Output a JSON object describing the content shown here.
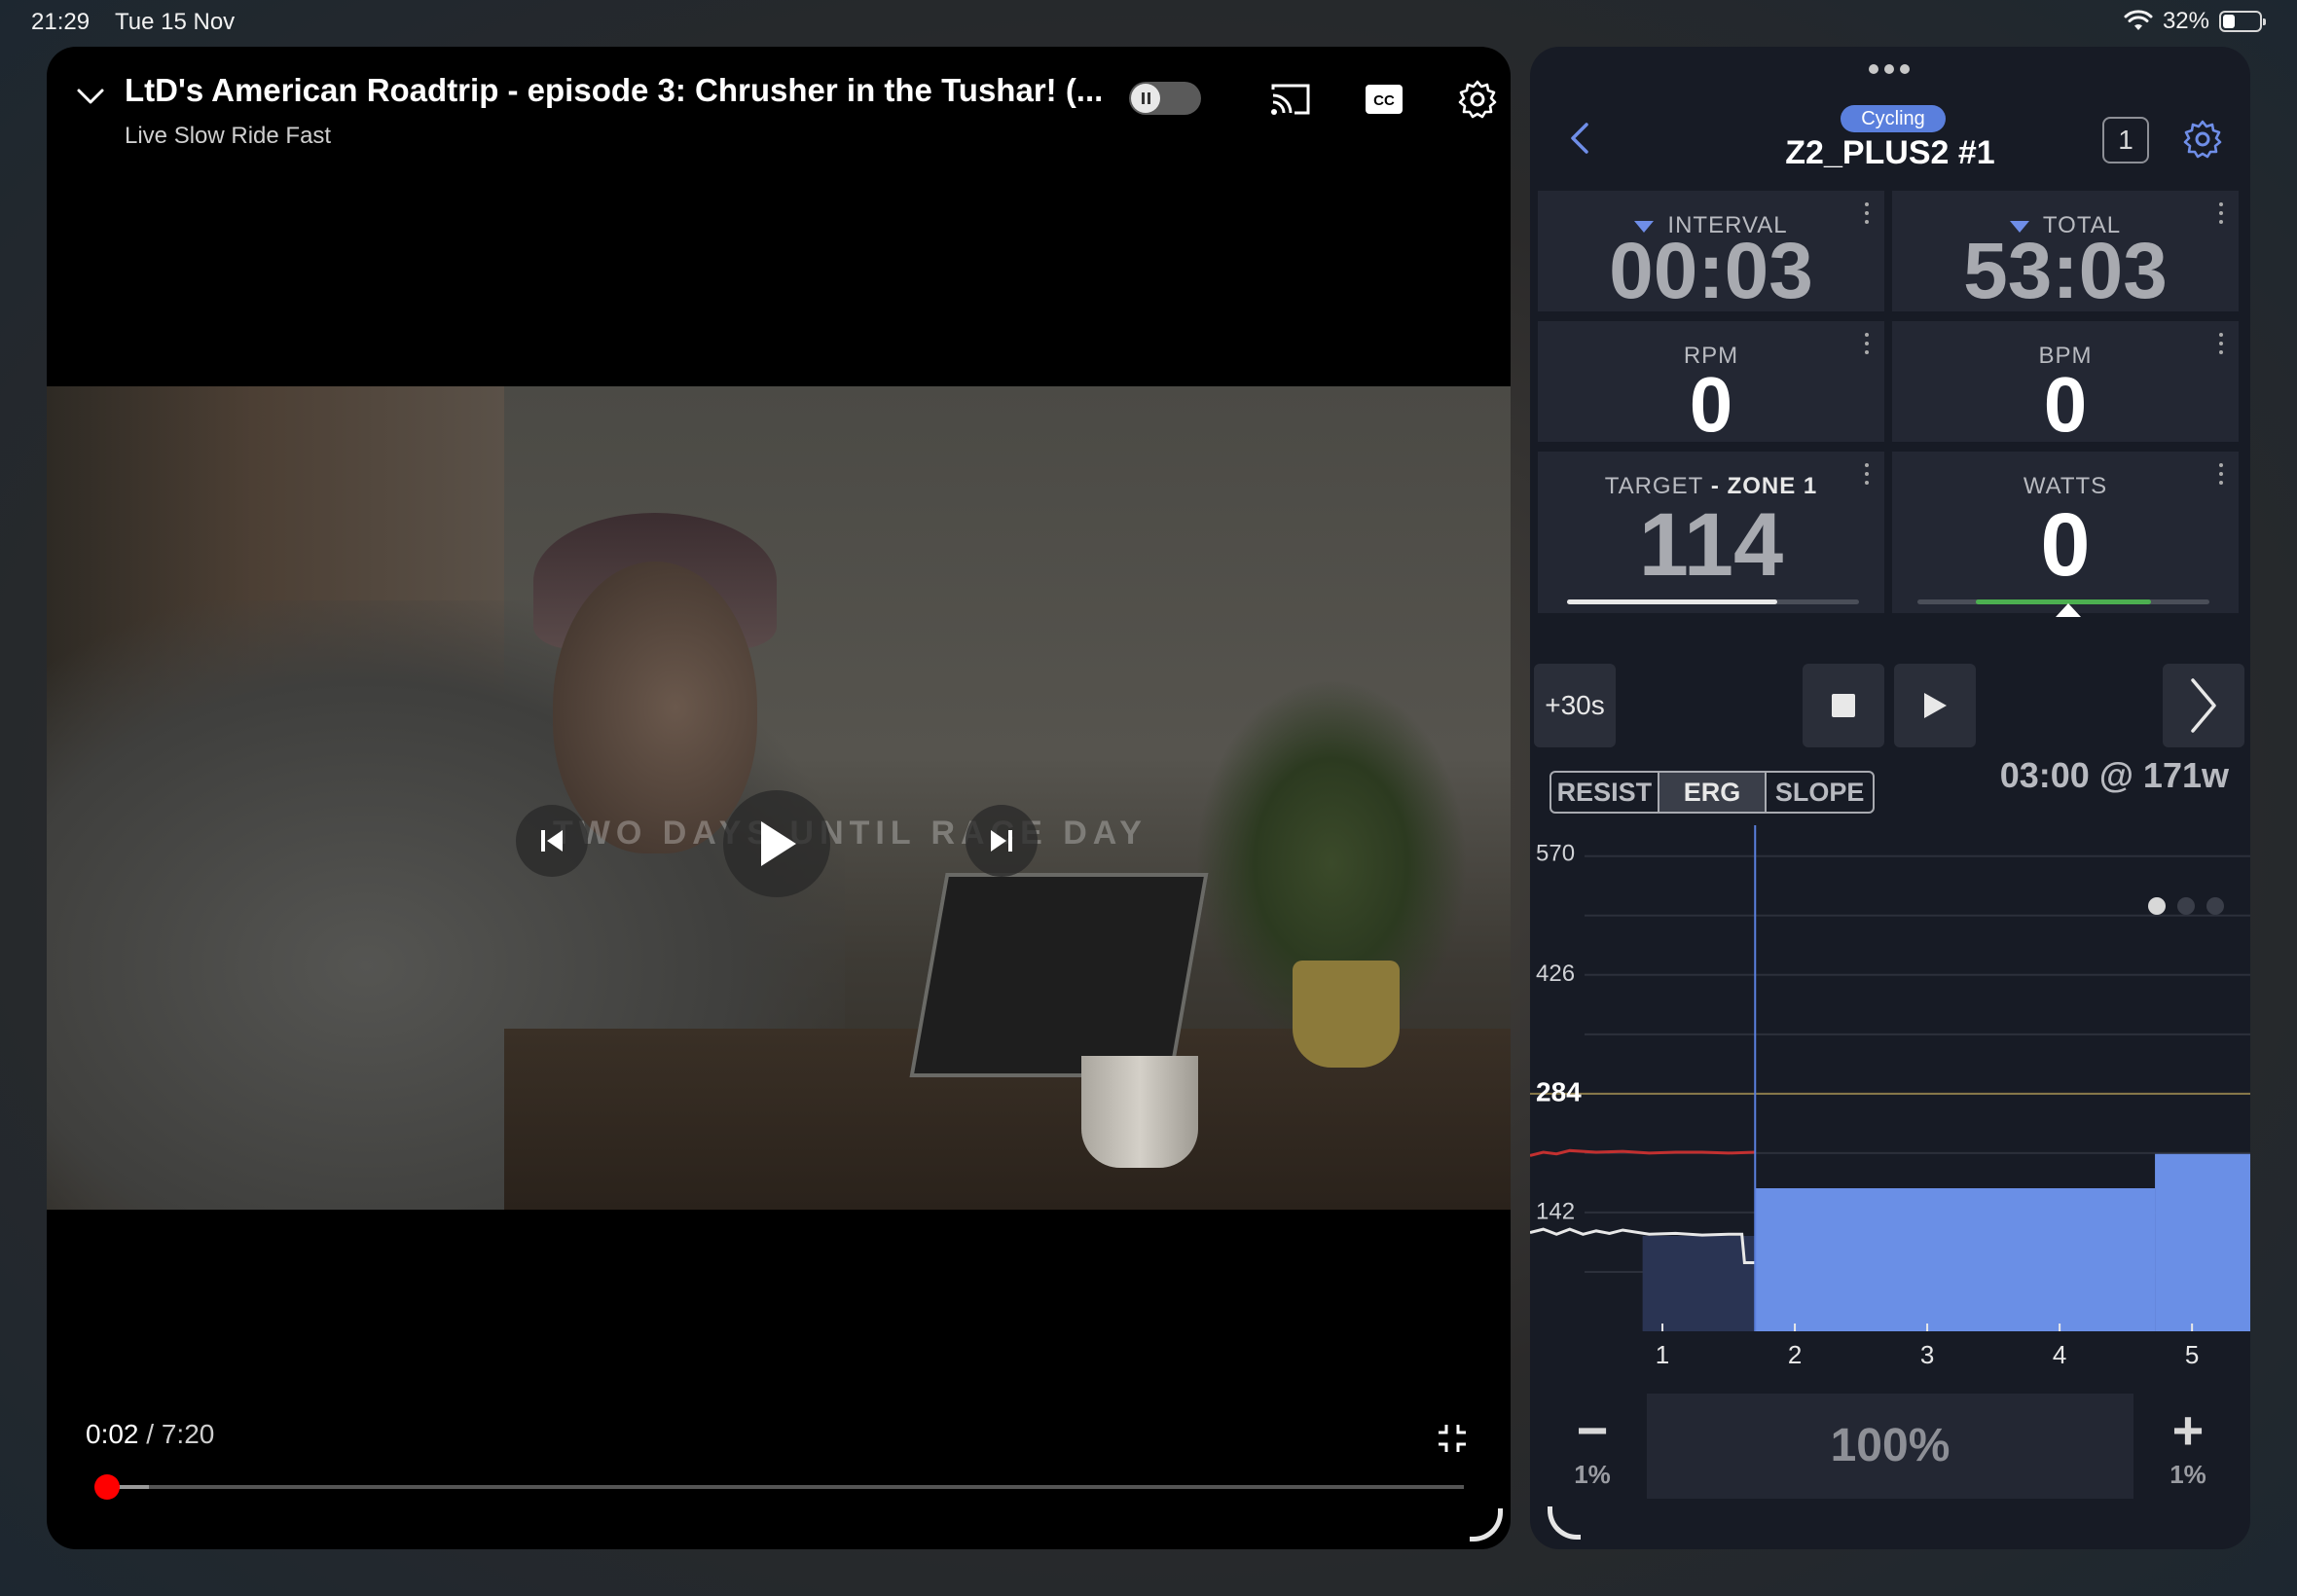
{
  "status_bar": {
    "time": "21:29",
    "date": "Tue 15 Nov",
    "battery": "32%",
    "battery_level": 0.32
  },
  "video": {
    "title": "LtD's American Roadtrip  - episode 3: Chrusher in the Tushar! (...",
    "channel": "Live Slow Ride Fast",
    "overlay_text": "TWO DAYS UNTIL RACE DAY",
    "current_time": "0:02",
    "duration_separator": " / ",
    "duration": "7:20",
    "played_fraction": 0.0046,
    "buffered_fraction": 0.035,
    "icons": [
      "chevron-down-icon",
      "pause-toggle",
      "cast-icon",
      "cc-icon",
      "gear-icon",
      "previous-icon",
      "play-icon",
      "next-icon",
      "exit-fullscreen-icon"
    ],
    "accent_color": "#ff0000"
  },
  "app": {
    "sport": "Cycling",
    "workout_name": "Z2_PLUS2 #1",
    "lap": "1",
    "tiles": {
      "interval": {
        "label": "INTERVAL",
        "value": "00:03"
      },
      "total": {
        "label": "TOTAL",
        "value": "53:03"
      },
      "rpm": {
        "label": "RPM",
        "value": "0"
      },
      "bpm": {
        "label": "BPM",
        "value": "0"
      },
      "target": {
        "label": "TARGET",
        "dash": " - ",
        "zone": "ZONE 1",
        "value": "114"
      },
      "watts": {
        "label": "WATTS",
        "value": "0"
      }
    },
    "target_bar_fraction": 0.72,
    "controls": {
      "add30": "+30s",
      "modes": [
        "RESIST",
        "ERG",
        "SLOPE"
      ],
      "active_mode": "ERG",
      "next_step": "03:00 @ 171w"
    },
    "intensity": {
      "value": "100%",
      "minus_step": "1%",
      "plus_step": "1%"
    },
    "colors": {
      "accent": "#6f8ee8",
      "block": "#6a8fe6",
      "ftp_line": "#8a7a4a",
      "power_line": "#c23030"
    }
  },
  "chart_data": {
    "type": "area",
    "y_ticks": [
      142,
      284,
      426,
      570
    ],
    "x_ticks": [
      1,
      2,
      3,
      4,
      5
    ],
    "ylim": [
      0,
      570
    ],
    "xlim": [
      0.0,
      5.44
    ],
    "highlight_y": 284,
    "current_x": 1.7,
    "blocks": [
      {
        "x0": 0.85,
        "x1": 1.7,
        "y": 114,
        "completed": true
      },
      {
        "x0": 1.7,
        "x1": 4.72,
        "y": 171,
        "completed": false
      },
      {
        "x0": 4.72,
        "x1": 5.44,
        "y": 212,
        "completed": false
      }
    ],
    "series": [
      {
        "name": "heart-rate",
        "x": [
          0.0,
          0.1,
          0.2,
          0.3,
          0.5,
          0.7,
          0.9,
          1.1,
          1.3,
          1.5,
          1.7
        ],
        "y": [
          210,
          214,
          212,
          216,
          214,
          215,
          213,
          214,
          214,
          213,
          214
        ]
      },
      {
        "name": "power",
        "x": [
          0.0,
          0.1,
          0.2,
          0.3,
          0.4,
          0.5,
          0.6,
          0.7,
          0.9,
          1.1,
          1.3,
          1.5,
          1.6,
          1.62,
          1.7
        ],
        "y": [
          118,
          122,
          116,
          122,
          116,
          120,
          117,
          121,
          116,
          117,
          115,
          116,
          116,
          82,
          82
        ]
      }
    ],
    "page_dots": 3,
    "active_page": 0
  }
}
